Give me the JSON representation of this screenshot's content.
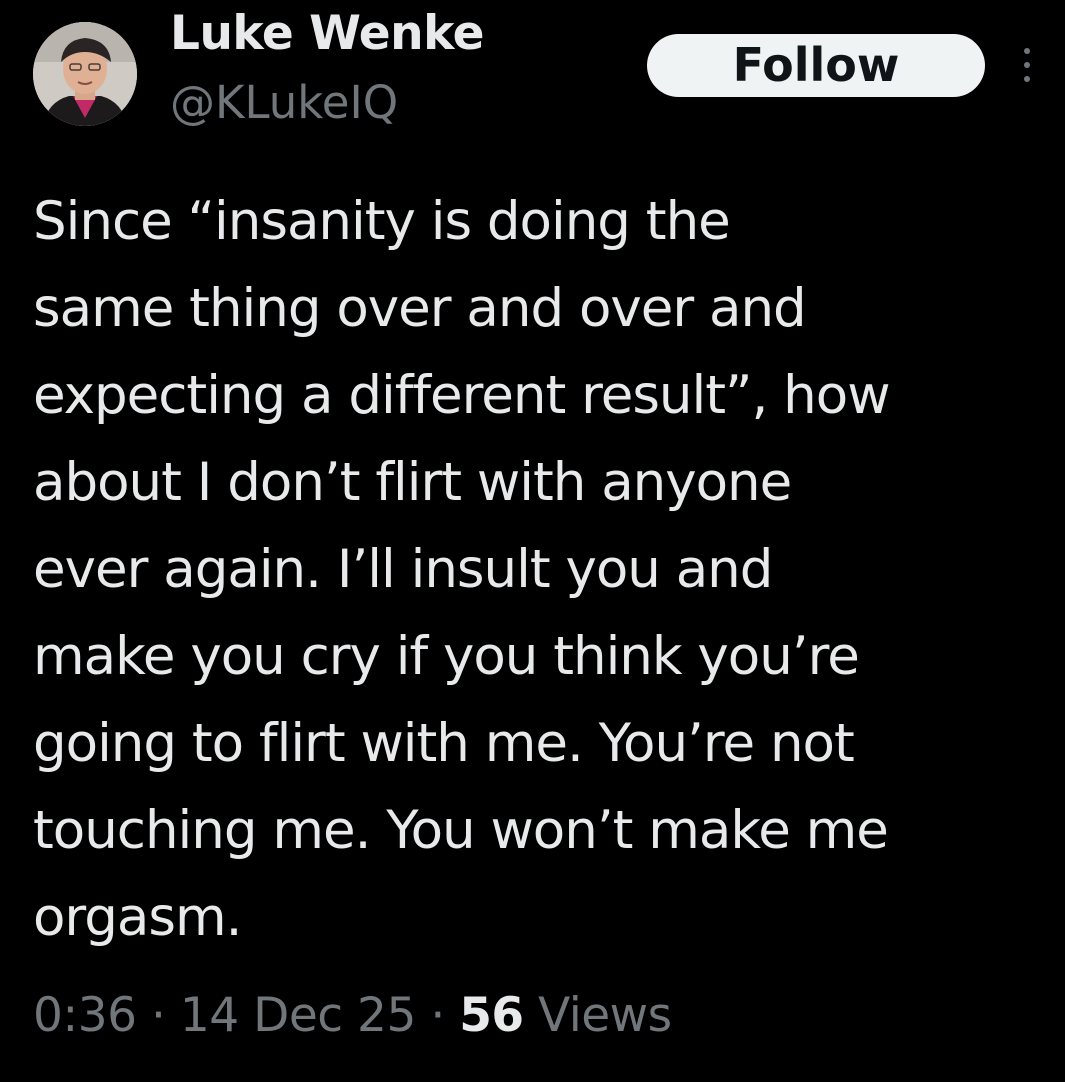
{
  "author": {
    "display_name": "Luke Wenke",
    "handle": "@KLukeIQ"
  },
  "actions": {
    "follow_label": "Follow"
  },
  "tweet": {
    "lines": [
      "Since “insanity is doing the",
      "same thing over and over and",
      "expecting a different result”, how",
      "about I don’t flirt with anyone",
      "ever again.  I’ll insult you and",
      "make you cry if you think you’re",
      "going to flirt with me.  You’re not",
      "touching me.  You won’t make me",
      "orgasm."
    ]
  },
  "meta": {
    "time": "0:36",
    "separator": "·",
    "date": "14 Dec 25",
    "views_count": "56",
    "views_label": "Views"
  },
  "colors": {
    "background": "#000000",
    "primary_text": "#e7e9ea",
    "secondary_text": "#71767b",
    "follow_button_bg": "#eff3f4",
    "follow_button_text": "#0f1419"
  },
  "icons": {
    "more": "more-vertical-icon",
    "avatar": "user-avatar"
  }
}
